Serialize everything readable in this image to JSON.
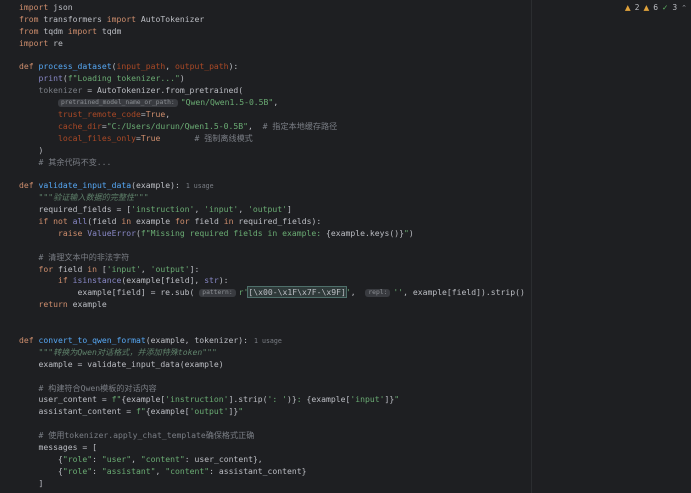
{
  "inspections": {
    "warnings_a": "2",
    "warnings_b": "6",
    "ok": "3"
  },
  "lines": [
    [
      [
        "kw",
        "import"
      ],
      [
        "t",
        " json"
      ]
    ],
    [
      [
        "kw",
        "from"
      ],
      [
        "t",
        " transformers "
      ],
      [
        "kw",
        "import"
      ],
      [
        "t",
        " AutoTokenizer"
      ]
    ],
    [
      [
        "kw",
        "from"
      ],
      [
        "t",
        " tqdm "
      ],
      [
        "kw",
        "import"
      ],
      [
        "t",
        " tqdm"
      ]
    ],
    [
      [
        "kw",
        "import"
      ],
      [
        "t",
        " re"
      ]
    ],
    [],
    [
      [
        "kw",
        "def "
      ],
      [
        "fn",
        "process_dataset"
      ],
      [
        "t",
        "("
      ],
      [
        "par",
        "input_path"
      ],
      [
        "t",
        ", "
      ],
      [
        "par",
        "output_path"
      ],
      [
        "t",
        "):"
      ]
    ],
    [
      [
        "t",
        "    "
      ],
      [
        "bi",
        "print"
      ],
      [
        "t",
        "("
      ],
      [
        "str",
        "f\"Loading tokenizer...\""
      ],
      [
        "t",
        ")"
      ]
    ],
    [
      [
        "t",
        "    "
      ],
      [
        "cm",
        "tokenizer"
      ],
      [
        "t",
        " = AutoTokenizer.from_pretrained("
      ]
    ],
    [
      [
        "t",
        "        "
      ],
      [
        "hint",
        "pretrained_model_name_or_path:"
      ],
      [
        "str",
        "\"Qwen/Qwen1.5-0.5B\""
      ],
      [
        "t",
        ","
      ]
    ],
    [
      [
        "t",
        "        "
      ],
      [
        "par",
        "trust_remote_code"
      ],
      [
        "t",
        "="
      ],
      [
        "kw",
        "True"
      ],
      [
        "t",
        ","
      ]
    ],
    [
      [
        "t",
        "        "
      ],
      [
        "par",
        "cache_dir"
      ],
      [
        "t",
        "="
      ],
      [
        "str",
        "\"C:/Users/durun/Qwen1.5-0.5B\""
      ],
      [
        "t",
        ",  "
      ],
      [
        "cm",
        "# 指定本地缓存路径"
      ]
    ],
    [
      [
        "t",
        "        "
      ],
      [
        "par",
        "local_files_only"
      ],
      [
        "t",
        "="
      ],
      [
        "kw",
        "True"
      ],
      [
        "t",
        "       "
      ],
      [
        "cm",
        "# 强制离线模式"
      ]
    ],
    [
      [
        "t",
        "    )"
      ]
    ],
    [
      [
        "t",
        "    "
      ],
      [
        "cm",
        "# 其余代码不变..."
      ]
    ],
    [],
    [
      [
        "kw",
        "def "
      ],
      [
        "fn",
        "validate_input_data"
      ],
      [
        "t",
        "(example):"
      ],
      [
        "usage",
        "1 usage"
      ]
    ],
    [
      [
        "t",
        "    "
      ],
      [
        "doc",
        "\"\"\"验证输入数据的完整性\"\"\""
      ]
    ],
    [
      [
        "t",
        "    required_fields = ["
      ],
      [
        "str",
        "'instruction'"
      ],
      [
        "t",
        ", "
      ],
      [
        "str",
        "'input'"
      ],
      [
        "t",
        ", "
      ],
      [
        "str",
        "'output'"
      ],
      [
        "t",
        "]"
      ]
    ],
    [
      [
        "t",
        "    "
      ],
      [
        "kw",
        "if not "
      ],
      [
        "bi",
        "all"
      ],
      [
        "t",
        "(field "
      ],
      [
        "kw",
        "in"
      ],
      [
        "t",
        " example "
      ],
      [
        "kw",
        "for"
      ],
      [
        "t",
        " field "
      ],
      [
        "kw",
        "in"
      ],
      [
        "t",
        " required_fields):"
      ]
    ],
    [
      [
        "t",
        "        "
      ],
      [
        "kw",
        "raise "
      ],
      [
        "bi",
        "ValueError"
      ],
      [
        "t",
        "("
      ],
      [
        "str",
        "f\"Missing required fields in example: "
      ],
      [
        "t",
        "{example.keys()}"
      ],
      [
        "str",
        "\""
      ],
      [
        "t",
        ")"
      ]
    ],
    [],
    [
      [
        "t",
        "    "
      ],
      [
        "cm",
        "# 清理文本中的非法字符"
      ]
    ],
    [
      [
        "t",
        "    "
      ],
      [
        "kw",
        "for"
      ],
      [
        "t",
        " field "
      ],
      [
        "kw",
        "in"
      ],
      [
        "t",
        " ["
      ],
      [
        "str",
        "'input'"
      ],
      [
        "t",
        ", "
      ],
      [
        "str",
        "'output'"
      ],
      [
        "t",
        "]:"
      ]
    ],
    [
      [
        "t",
        "        "
      ],
      [
        "kw",
        "if "
      ],
      [
        "bi",
        "isinstance"
      ],
      [
        "t",
        "(example[field], "
      ],
      [
        "bi",
        "str"
      ],
      [
        "t",
        "):"
      ]
    ],
    [
      [
        "t",
        "            example[field] = re.sub( "
      ],
      [
        "hint",
        "pattern:"
      ],
      [
        "str",
        "r'"
      ],
      [
        "hl",
        "[\\x00-\\x1F\\x7F-\\x9F]"
      ],
      [
        "str",
        "'"
      ],
      [
        "t",
        ",  "
      ],
      [
        "hint",
        "repl:"
      ],
      [
        "str",
        "''"
      ],
      [
        "t",
        ", example[field]).strip()"
      ]
    ],
    [
      [
        "t",
        "    "
      ],
      [
        "kw",
        "return"
      ],
      [
        "t",
        " example"
      ]
    ],
    [],
    [],
    [
      [
        "kw",
        "def "
      ],
      [
        "fn",
        "convert_to_qwen_format"
      ],
      [
        "t",
        "(example, tokenizer):"
      ],
      [
        "usage",
        "1 usage"
      ]
    ],
    [
      [
        "t",
        "    "
      ],
      [
        "doc",
        "\"\"\"转换为Qwen对话格式，并添加特殊token\"\"\""
      ]
    ],
    [
      [
        "t",
        "    example = validate_input_data(example)"
      ]
    ],
    [],
    [
      [
        "t",
        "    "
      ],
      [
        "cm",
        "# 构建符合Qwen模板的对话内容"
      ]
    ],
    [
      [
        "t",
        "    user_content = "
      ],
      [
        "str",
        "f\""
      ],
      [
        "t",
        "{example["
      ],
      [
        "str",
        "'instruction'"
      ],
      [
        "t",
        "].strip("
      ],
      [
        "str",
        "': '"
      ],
      [
        "t",
        ")}"
      ],
      [
        "str",
        ": "
      ],
      [
        "t",
        "{example["
      ],
      [
        "str",
        "'input'"
      ],
      [
        "t",
        "]}"
      ],
      [
        "str",
        "\""
      ]
    ],
    [
      [
        "t",
        "    assistant_content = "
      ],
      [
        "str",
        "f\""
      ],
      [
        "t",
        "{example["
      ],
      [
        "str",
        "'output'"
      ],
      [
        "t",
        "]}"
      ],
      [
        "str",
        "\""
      ]
    ],
    [],
    [
      [
        "t",
        "    "
      ],
      [
        "cm",
        "# 使用tokenizer.apply_chat_template确保格式正确"
      ]
    ],
    [
      [
        "t",
        "    messages = ["
      ]
    ],
    [
      [
        "t",
        "        {"
      ],
      [
        "str",
        "\"role\""
      ],
      [
        "t",
        ": "
      ],
      [
        "str",
        "\"user\""
      ],
      [
        "t",
        ", "
      ],
      [
        "str",
        "\"content\""
      ],
      [
        "t",
        ": user_content},"
      ]
    ],
    [
      [
        "t",
        "        {"
      ],
      [
        "str",
        "\"role\""
      ],
      [
        "t",
        ": "
      ],
      [
        "str",
        "\"assistant\""
      ],
      [
        "t",
        ", "
      ],
      [
        "str",
        "\"content\""
      ],
      [
        "t",
        ": assistant_content}"
      ]
    ],
    [
      [
        "t",
        "    ]"
      ]
    ]
  ]
}
